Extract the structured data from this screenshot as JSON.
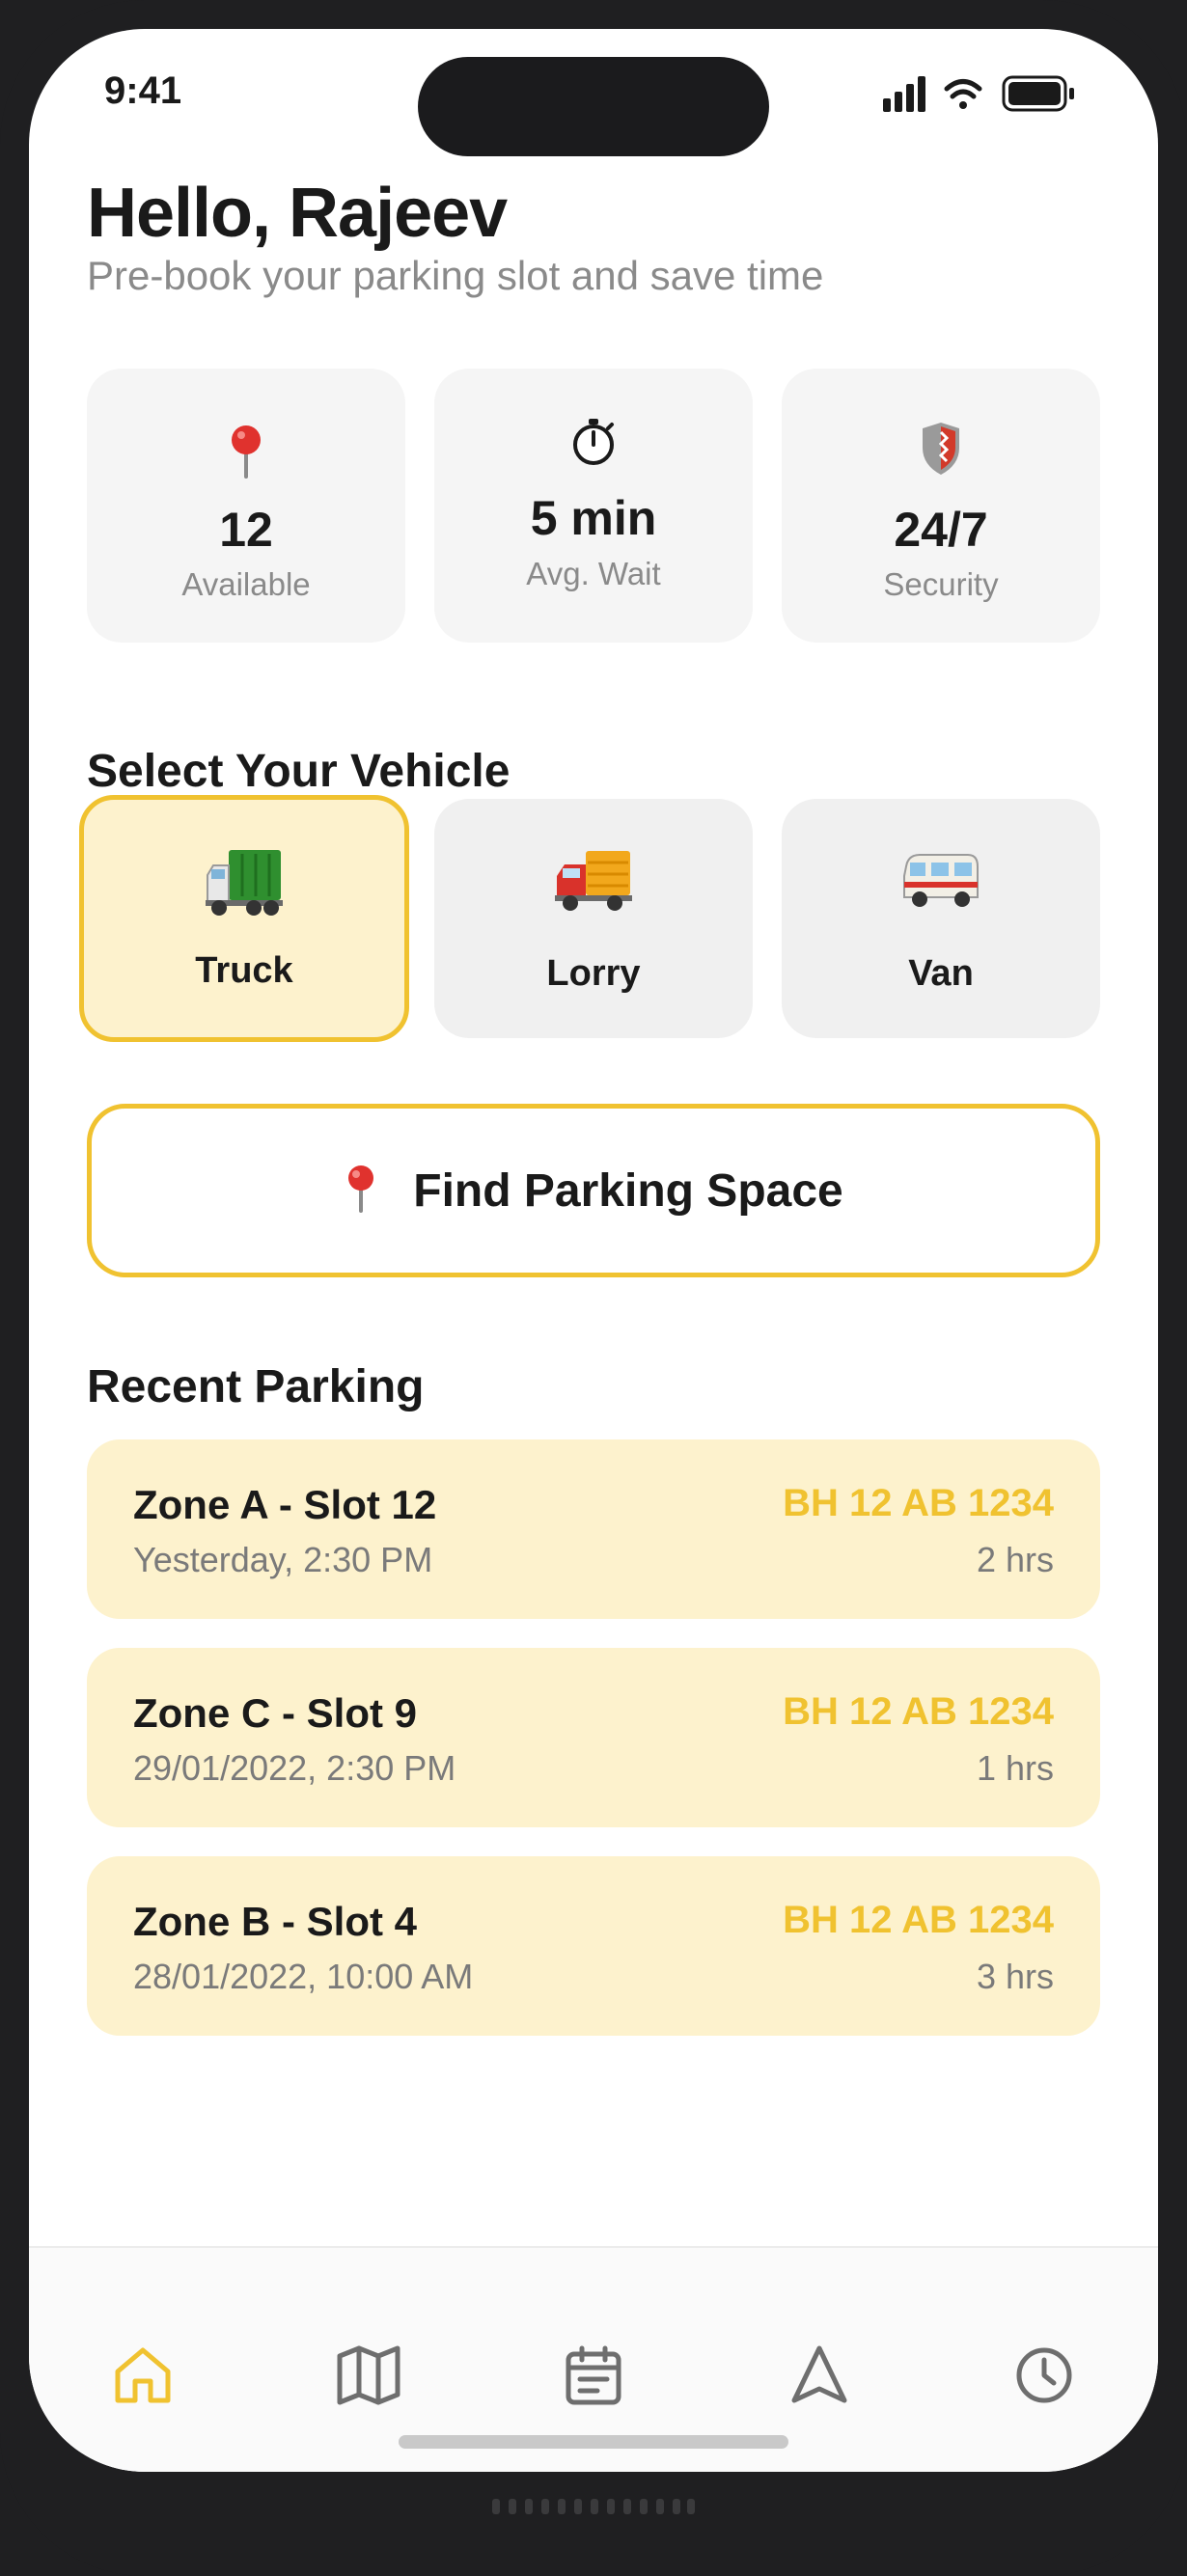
{
  "status": {
    "time": "9:41"
  },
  "header": {
    "greeting": "Hello, Rajeev",
    "subtitle": "Pre-book your parking slot and save time"
  },
  "stats": [
    {
      "icon": "map-pin-icon",
      "value": "12",
      "label": "Available"
    },
    {
      "icon": "stopwatch-icon",
      "value": "5 min",
      "label": "Avg. Wait"
    },
    {
      "icon": "shield-icon",
      "value": "24/7",
      "label": "Security"
    }
  ],
  "vehicles": {
    "title": "Select Your Vehicle",
    "selected": "Truck",
    "items": [
      {
        "label": "Truck",
        "icon": "truck-icon"
      },
      {
        "label": "Lorry",
        "icon": "lorry-icon"
      },
      {
        "label": "Van",
        "icon": "van-icon"
      }
    ]
  },
  "find_button": {
    "label": "Find Parking Space",
    "icon": "map-pin-icon"
  },
  "recent": {
    "title": "Recent Parking",
    "items": [
      {
        "zone": "Zone A - Slot 12",
        "time": "Yesterday, 2:30 PM",
        "plate": "BH 12 AB 1234",
        "duration": "2 hrs"
      },
      {
        "zone": "Zone C - Slot 9",
        "time": "29/01/2022, 2:30 PM",
        "plate": "BH 12 AB 1234",
        "duration": "1 hrs"
      },
      {
        "zone": "Zone B - Slot 4",
        "time": "28/01/2022, 10:00 AM",
        "plate": "BH 12 AB 1234",
        "duration": "3 hrs"
      }
    ]
  },
  "tabs": [
    {
      "icon": "home-icon",
      "active": true
    },
    {
      "icon": "map-icon",
      "active": false
    },
    {
      "icon": "calendar-icon",
      "active": false
    },
    {
      "icon": "navigation-icon",
      "active": false
    },
    {
      "icon": "clock-icon",
      "active": false
    }
  ],
  "colors": {
    "accent": "#f0c230",
    "card_highlight": "#fdf2cd",
    "card_neutral": "#f5f5f5",
    "text_primary": "#1a1a1a",
    "text_secondary": "#8a8a8a",
    "tab_inactive": "#6e6e6e"
  }
}
